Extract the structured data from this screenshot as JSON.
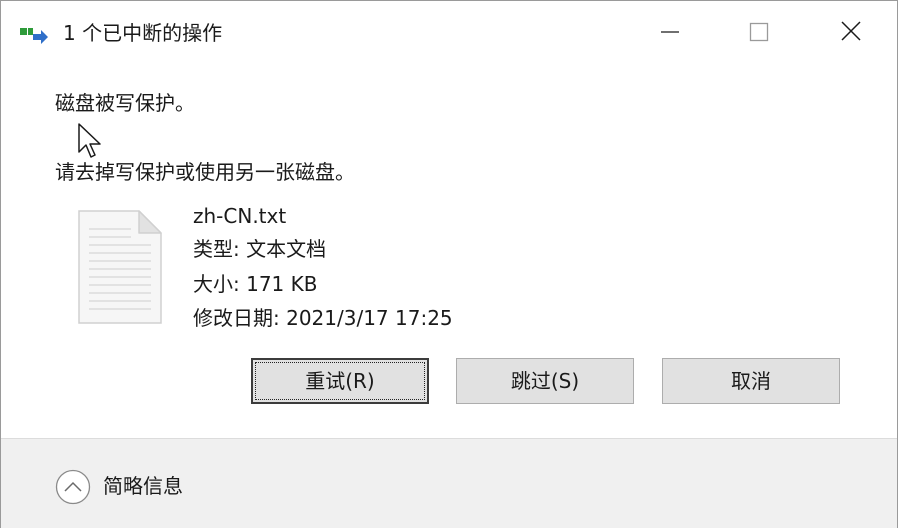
{
  "window": {
    "title": "1 个已中断的操作"
  },
  "icons": {
    "title": "file-move-icon",
    "minimize": "minimize-icon",
    "maximize": "maximize-icon",
    "close": "close-icon",
    "file": "text-document-icon",
    "cursor": "mouse-pointer-icon",
    "details": "chevron-up-circle-icon"
  },
  "message": {
    "main": "磁盘被写保护。",
    "sub": "请去掉写保护或使用另一张磁盘。"
  },
  "file": {
    "name": "zh-CN.txt",
    "type": "类型: 文本文档",
    "size": "大小: 171 KB",
    "modified": "修改日期: 2021/3/17 17:25"
  },
  "buttons": {
    "retry": "重试(R)",
    "skip": "跳过(S)",
    "cancel": "取消"
  },
  "footer": {
    "details": "简略信息"
  },
  "colors": {
    "button_bg": "#e1e1e1",
    "footer_bg": "#f0f0f0",
    "accent_green": "#2e9b3a",
    "accent_blue": "#2f6fc9"
  }
}
